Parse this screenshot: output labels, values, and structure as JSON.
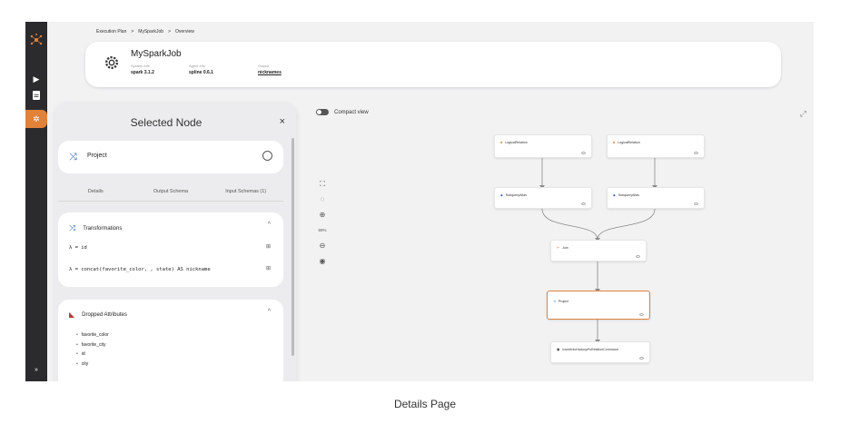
{
  "breadcrumb": [
    "Execution Plan",
    ">",
    "MySparkJob",
    ">",
    "Overview"
  ],
  "job": {
    "title": "MySparkJob",
    "system_info_label": "System info",
    "system_info_value": "spark 3.1.2",
    "agent_info_label": "Agent info",
    "agent_info_value": "spline 0.6.1",
    "output_label": "Output",
    "output_value": "nicknames"
  },
  "panel": {
    "title": "Selected Node",
    "close": "×",
    "node_label": "Project",
    "tabs": [
      "Details",
      "Output Schema",
      "Input Schemas (1)"
    ],
    "transformations": {
      "title": "Transformations",
      "rows": [
        "λ = id",
        "λ = concat(favorite_color, , state) AS nickname"
      ]
    },
    "dropped": {
      "title": "Dropped Attributes",
      "items": [
        "favorite_color",
        "favorite_city",
        "id",
        "city"
      ]
    }
  },
  "graph": {
    "compact_label": "Compact view",
    "zoom_level": "59%",
    "nodes": {
      "lr1": "LogicalRelation",
      "lr2": "LogicalRelation",
      "sa1": "SubqueryAlias",
      "sa2": "SubqueryAlias",
      "join": "Join",
      "project": "Project",
      "insert": "InsertIntoHadoopFsRelationCommand"
    }
  },
  "caption": "Details Page",
  "colors": {
    "accent": "#e0823a",
    "rail": "#2b2b2e",
    "link_blue": "#2f67b0"
  }
}
